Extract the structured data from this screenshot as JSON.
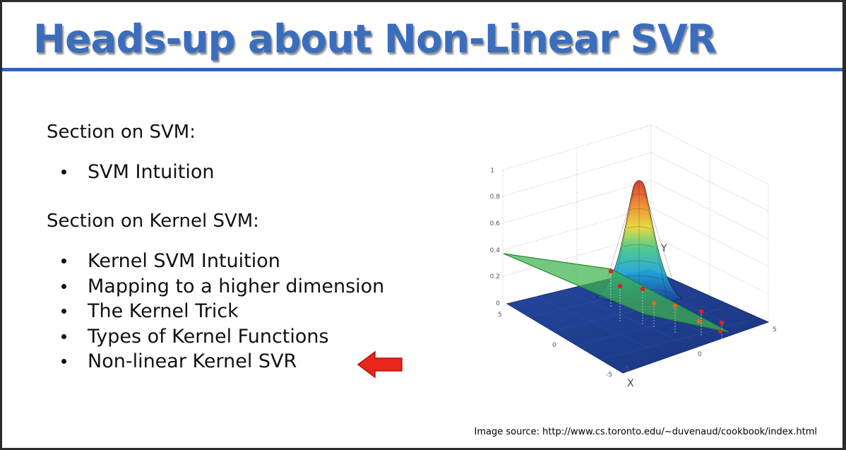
{
  "slide": {
    "title": "Heads-up about Non-Linear SVR",
    "sections": [
      {
        "heading": "Section on SVM:",
        "bullets": [
          "SVM Intuition"
        ]
      },
      {
        "heading": "Section on Kernel SVM:",
        "bullets": [
          "Kernel SVM Intuition",
          "Mapping to a higher dimension",
          "The Kernel Trick",
          "Types of Kernel Functions",
          "Non-linear Kernel SVR"
        ]
      }
    ],
    "highlight_arrow": {
      "points_to": "Non-linear Kernel SVR",
      "color": "#e8261a",
      "icon": "left-arrow-icon"
    },
    "figure": {
      "z_ticks": [
        "1",
        "0.8",
        "0.6",
        "0.4",
        "0.2",
        "0"
      ],
      "y_axis_label": "Y",
      "x_axis_label": "X",
      "x_ticks": [
        "5",
        "0",
        "-5"
      ],
      "y_ticks": [
        "-5",
        "0",
        "5"
      ]
    },
    "image_source": "Image source: http://www.cs.toronto.edu/~duvenaud/cookbook/index.html"
  },
  "colors": {
    "title": "#3a6ebd",
    "title_rule": "#2f67b3",
    "surface_floor": "#1f3f8f",
    "plane": "#3fb34f",
    "data_points": "#e02020"
  }
}
